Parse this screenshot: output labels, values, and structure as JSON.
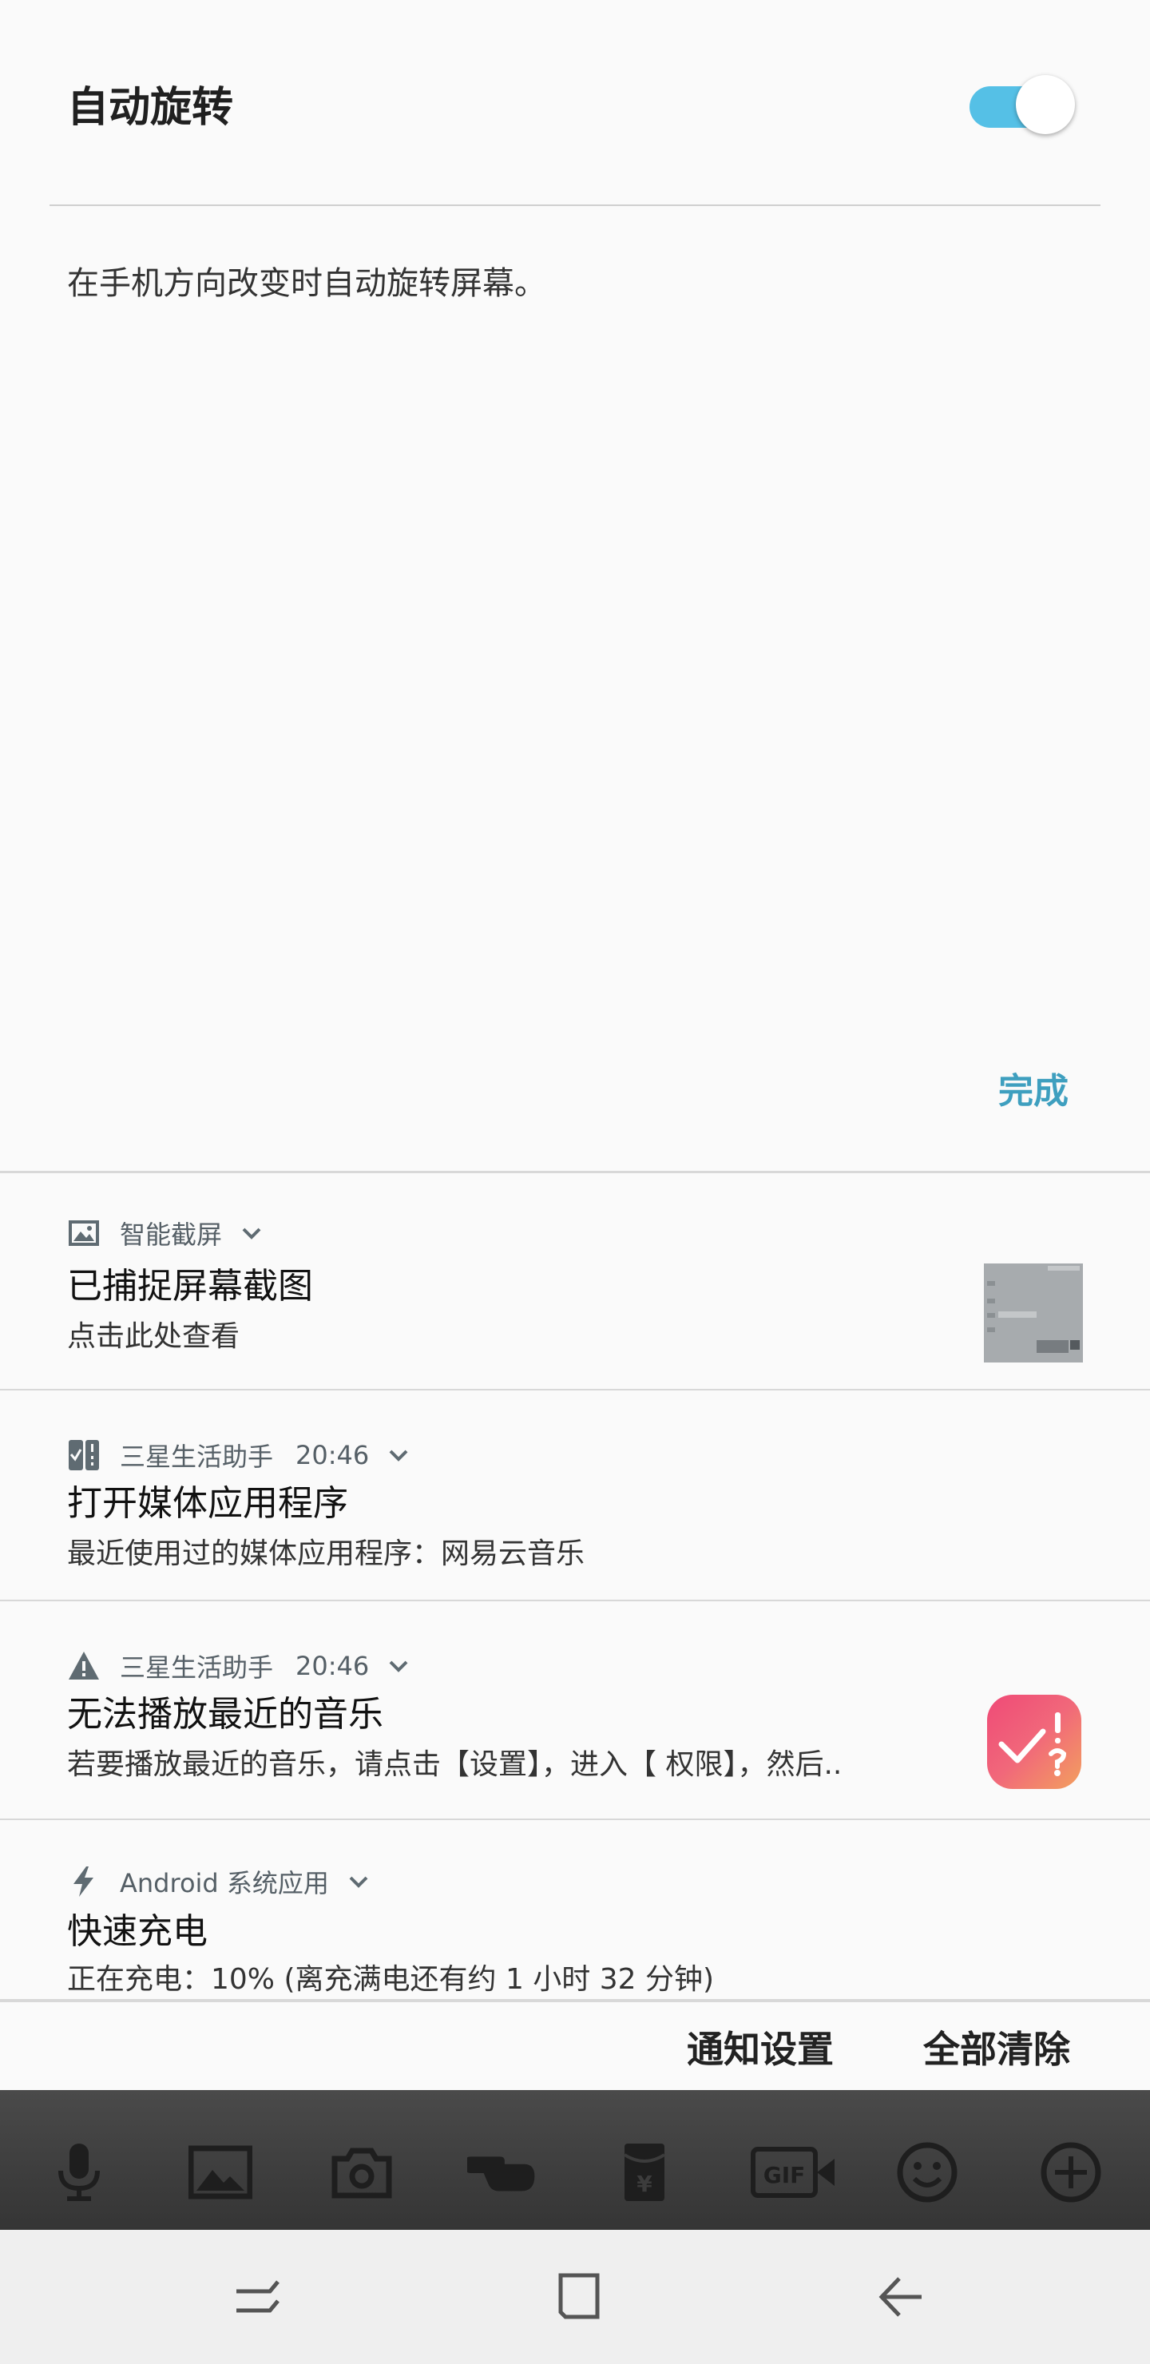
{
  "quick_setting": {
    "title": "自动旋转",
    "toggle_on": true,
    "description": "在手机方向改变时自动旋转屏幕。",
    "done_label": "完成",
    "accent_color": "#55c0e6",
    "done_color": "#3e9fbf"
  },
  "notifications": [
    {
      "icon": "image-icon",
      "app": "智能截屏",
      "time": "",
      "title": "已捕捉屏幕截图",
      "text": "点击此处查看",
      "has_thumbnail": true
    },
    {
      "icon": "checklist-icon",
      "app": "三星生活助手",
      "time": "20:46",
      "title": "打开媒体应用程序",
      "text": "最近使用过的媒体应用程序：网易云音乐"
    },
    {
      "icon": "warning-icon",
      "app": "三星生活助手",
      "time": "20:46",
      "title": "无法播放最近的音乐",
      "text": "若要播放最近的音乐，请点击【设置】，进入【 权限】，然后..",
      "has_app_icon": true
    },
    {
      "icon": "bolt-icon",
      "app": "Android 系统应用",
      "time": "",
      "title": "快速充电",
      "text": "正在充电：10% (离充满电还有约 1 小时 32 分钟)"
    }
  ],
  "footer": {
    "settings_label": "通知设置",
    "clear_all_label": "全部清除"
  },
  "chat_toolbar": {
    "icons": [
      "microphone-icon",
      "image-icon",
      "camera-icon",
      "poke-icon",
      "red-packet-icon",
      "gif-icon",
      "emoji-icon",
      "add-icon"
    ]
  },
  "nav_bar": {
    "icons": [
      "recent-apps-icon",
      "home-icon",
      "back-icon"
    ]
  }
}
